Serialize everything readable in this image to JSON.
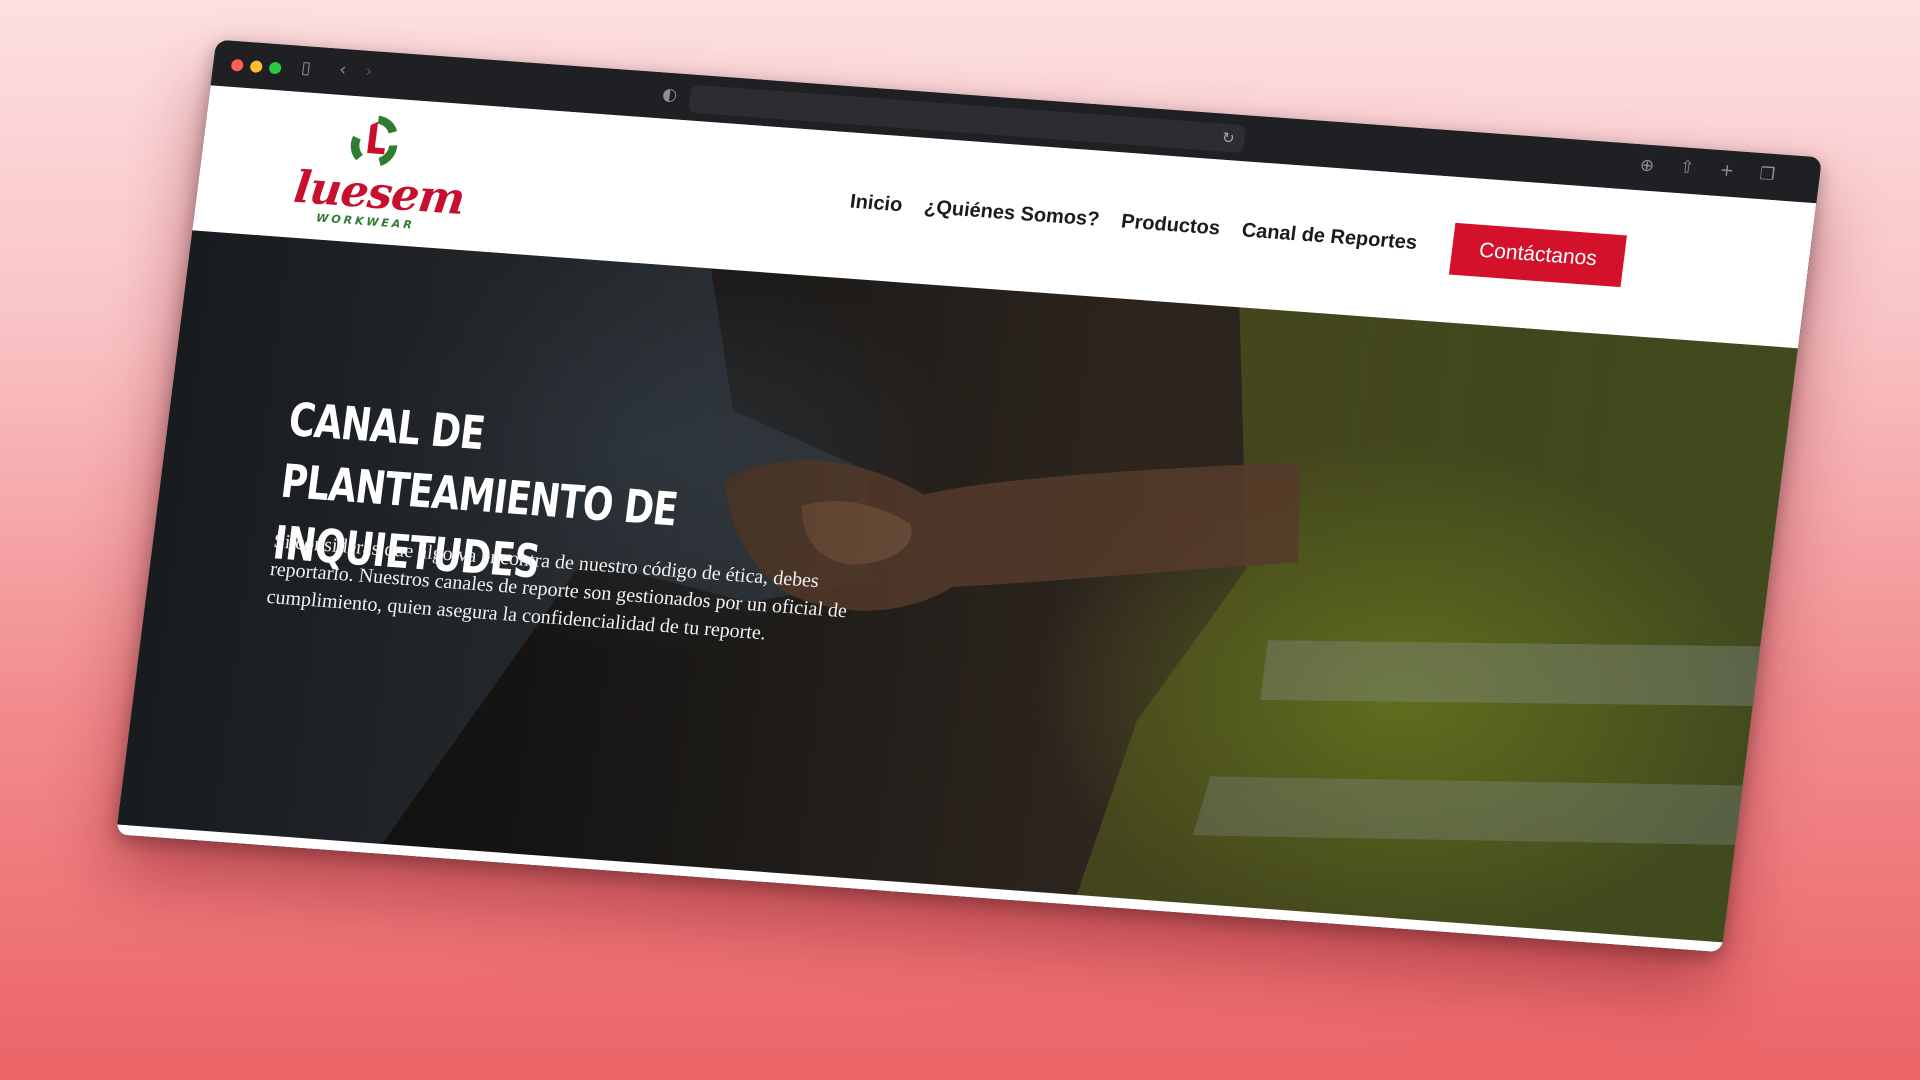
{
  "browser": {
    "icons": [
      "sidebar-icon",
      "back-icon",
      "forward-icon",
      "shield-icon",
      "reload-icon",
      "download-icon",
      "share-icon",
      "new-tab-icon",
      "tabs-overview-icon"
    ]
  },
  "logo": {
    "wordmark": "luesem",
    "subtitle": "WORKWEAR",
    "colors": {
      "red": "#c8102e",
      "green": "#2e7d32"
    }
  },
  "nav": {
    "items": [
      {
        "label": "Inicio"
      },
      {
        "label": "¿Quiénes Somos?"
      },
      {
        "label": "Productos"
      },
      {
        "label": "Canal de Reportes"
      }
    ],
    "cta_label": "Contáctanos",
    "cta_color": "#d4112b"
  },
  "hero": {
    "title": "CANAL DE PLANTEAMIENTO DE INQUIETUDES",
    "text": "Si consideras que algo va encontra de nuestro código de ética, debes reportarlo. Nuestros canales de reporte son gestionados por un oficial de cumplimiento, quien asegura la confidencialidad de tu reporte."
  }
}
